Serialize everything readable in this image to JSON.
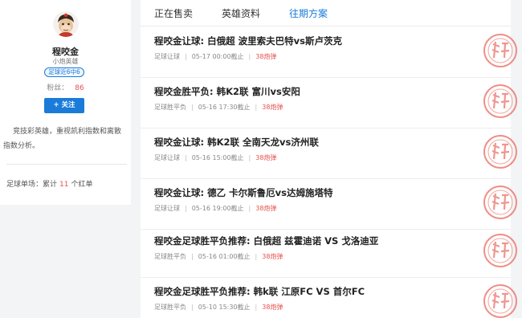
{
  "profile": {
    "name": "程咬金",
    "title": "小炮英雄",
    "badge": "足球近6中6",
    "fans_label": "粉丝：",
    "fans_count": "86",
    "follow_label": "+ 关注",
    "description": "竞技彩英雄，重视凯利指数和离散指数分析。",
    "stat_prefix": "足球单场：累计",
    "stat_value": "11",
    "stat_suffix": "个红单"
  },
  "tabs": [
    {
      "label": "正在售卖",
      "active": false
    },
    {
      "label": "英雄资料",
      "active": false
    },
    {
      "label": "往期方案",
      "active": true
    }
  ],
  "items": [
    {
      "title": "程咬金让球: 白俄超 波里索夫巴特vs斯卢茨克",
      "category": "足球让球",
      "time": "05-17 00:00截止",
      "price": "38炮弹"
    },
    {
      "title": "程咬金胜平负: 韩K2联 富川vs安阳",
      "category": "足球胜平负",
      "time": "05-16 17:30截止",
      "price": "38炮弹"
    },
    {
      "title": "程咬金让球: 韩K2联 全南天龙vs济州联",
      "category": "足球让球",
      "time": "05-16 15:00截止",
      "price": "38炮弹"
    },
    {
      "title": "程咬金让球: 德乙 卡尔斯鲁厄vs达姆施塔特",
      "category": "足球让球",
      "time": "05-16 19:00截止",
      "price": "38炮弹"
    },
    {
      "title": "程咬金足球胜平负推荐: 白俄超 兹霍迪诺 VS 戈洛迪亚",
      "category": "足球胜平负",
      "time": "05-16 01:00截止",
      "price": "38炮弹"
    },
    {
      "title": "程咬金足球胜平负推荐: 韩k联 江原FC VS 首尔FC",
      "category": "足球胜平负",
      "time": "05-10 15:30截止",
      "price": "38炮弹"
    }
  ],
  "colors": {
    "accent": "#1a7bd9",
    "price": "#e5524c",
    "stamp": "#e8695f"
  },
  "icons": {
    "avatar": "monkey-king-avatar",
    "stamp": "red-win-stamp"
  }
}
